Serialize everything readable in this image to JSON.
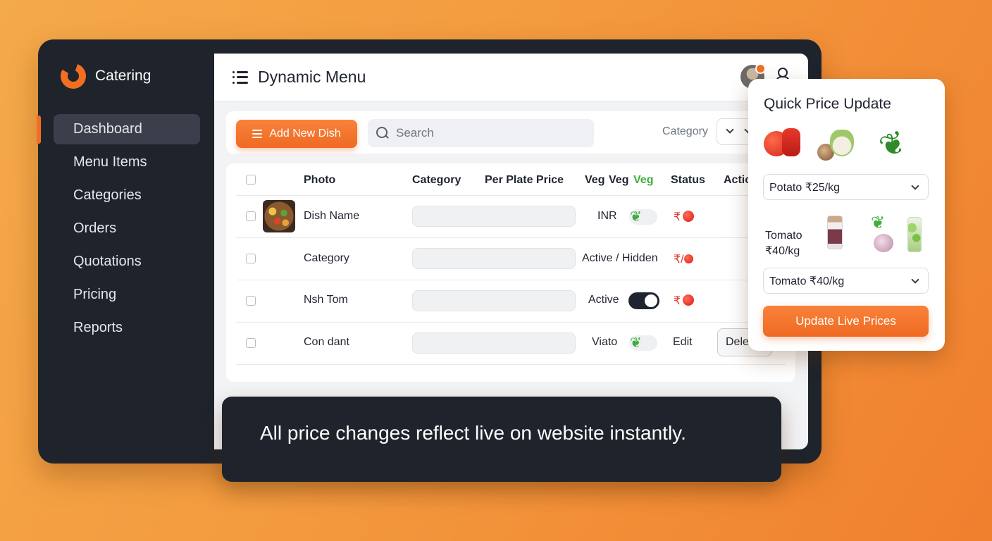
{
  "app": {
    "brand_name": "Catering"
  },
  "sidebar": {
    "items": [
      {
        "label": "Dashboard",
        "active": true
      },
      {
        "label": "Menu Items"
      },
      {
        "label": "Categories"
      },
      {
        "label": "Orders"
      },
      {
        "label": "Quotations"
      },
      {
        "label": "Pricing"
      },
      {
        "label": "Reports"
      }
    ]
  },
  "header": {
    "title": "Dynamic Menu"
  },
  "toolbar": {
    "add_label": "Add New Dish",
    "search_placeholder": "Search",
    "category_label": "Category"
  },
  "table": {
    "headers": {
      "photo": "Photo",
      "category": "Category",
      "per_plate_price": "Per Plate Price",
      "veg1": "Veg",
      "veg2": "Veg",
      "veg3": "Veg",
      "status": "Status",
      "actions": "Actio"
    },
    "rows": [
      {
        "name": "Dish Name",
        "status_text": "INR",
        "price_symbol": "₹"
      },
      {
        "name": "Category",
        "status_text": "Active / Hidden",
        "price_symbol": "₹/"
      },
      {
        "name": "Nsh Tom",
        "status_text": "Active",
        "price_symbol": "₹"
      },
      {
        "name": "Con dant",
        "status_text": "Viato",
        "edit_label": "Edit",
        "delete_label": "Dele"
      }
    ]
  },
  "banner": {
    "text": "All price changes reflect live on website instantly."
  },
  "quick_price": {
    "title": "Quick Price Update",
    "select1": "Potato ₹25/kg",
    "label": "Tomato ₹40/kg",
    "select2": "Tomato ₹40/kg",
    "button": "Update Live Prices"
  },
  "colors": {
    "accent": "#f26f22",
    "sidebar_bg": "#1f232c",
    "veg_green": "#3fae3a",
    "price_red": "#e03a2a"
  },
  "icons": [
    "logo-icon",
    "menu-icon",
    "avatar-icon",
    "user-icon",
    "list-icon",
    "search-icon",
    "chevron-down-icon",
    "leaf-icon",
    "tomato-icon"
  ]
}
